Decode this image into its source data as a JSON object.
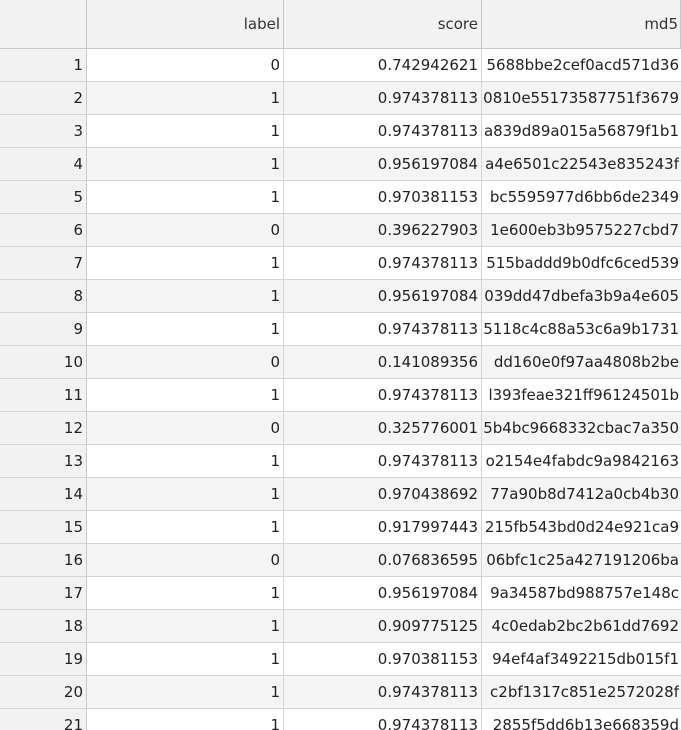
{
  "columns": {
    "index": "",
    "label": "label",
    "score": "score",
    "md5": "md5"
  },
  "rows": [
    {
      "idx": "1",
      "label": "0",
      "score": "0.742942621",
      "md5": "5688bbe2cef0acd571d36"
    },
    {
      "idx": "2",
      "label": "1",
      "score": "0.974378113",
      "md5": "0810e55173587751f3679"
    },
    {
      "idx": "3",
      "label": "1",
      "score": "0.974378113",
      "md5": "a839d89a015a56879f1b1"
    },
    {
      "idx": "4",
      "label": "1",
      "score": "0.956197084",
      "md5": "a4e6501c22543e835243f"
    },
    {
      "idx": "5",
      "label": "1",
      "score": "0.970381153",
      "md5": "bc5595977d6bb6de2349"
    },
    {
      "idx": "6",
      "label": "0",
      "score": "0.396227903",
      "md5": "1e600eb3b9575227cbd7"
    },
    {
      "idx": "7",
      "label": "1",
      "score": "0.974378113",
      "md5": "515baddd9b0dfc6ced539"
    },
    {
      "idx": "8",
      "label": "1",
      "score": "0.956197084",
      "md5": "039dd47dbefa3b9a4e605"
    },
    {
      "idx": "9",
      "label": "1",
      "score": "0.974378113",
      "md5": "5118c4c88a53c6a9b1731"
    },
    {
      "idx": "10",
      "label": "0",
      "score": "0.141089356",
      "md5": "dd160e0f97aa4808b2be"
    },
    {
      "idx": "11",
      "label": "1",
      "score": "0.974378113",
      "md5": "l393feae321ff96124501b"
    },
    {
      "idx": "12",
      "label": "0",
      "score": "0.325776001",
      "md5": "5b4bc9668332cbac7a350"
    },
    {
      "idx": "13",
      "label": "1",
      "score": "0.974378113",
      "md5": "o2154e4fabdc9a9842163"
    },
    {
      "idx": "14",
      "label": "1",
      "score": "0.970438692",
      "md5": "77a90b8d7412a0cb4b30"
    },
    {
      "idx": "15",
      "label": "1",
      "score": "0.917997443",
      "md5": "215fb543bd0d24e921ca9"
    },
    {
      "idx": "16",
      "label": "0",
      "score": "0.076836595",
      "md5": "06bfc1c25a427191206ba"
    },
    {
      "idx": "17",
      "label": "1",
      "score": "0.956197084",
      "md5": "9a34587bd988757e148c"
    },
    {
      "idx": "18",
      "label": "1",
      "score": "0.909775125",
      "md5": "4c0edab2bc2b61dd7692"
    },
    {
      "idx": "19",
      "label": "1",
      "score": "0.970381153",
      "md5": "94ef4af3492215db015f1"
    },
    {
      "idx": "20",
      "label": "1",
      "score": "0.974378113",
      "md5": "c2bf1317c851e2572028f"
    },
    {
      "idx": "21",
      "label": "1",
      "score": "0.974378113",
      "md5": "2855f5dd6b13e668359d"
    }
  ]
}
